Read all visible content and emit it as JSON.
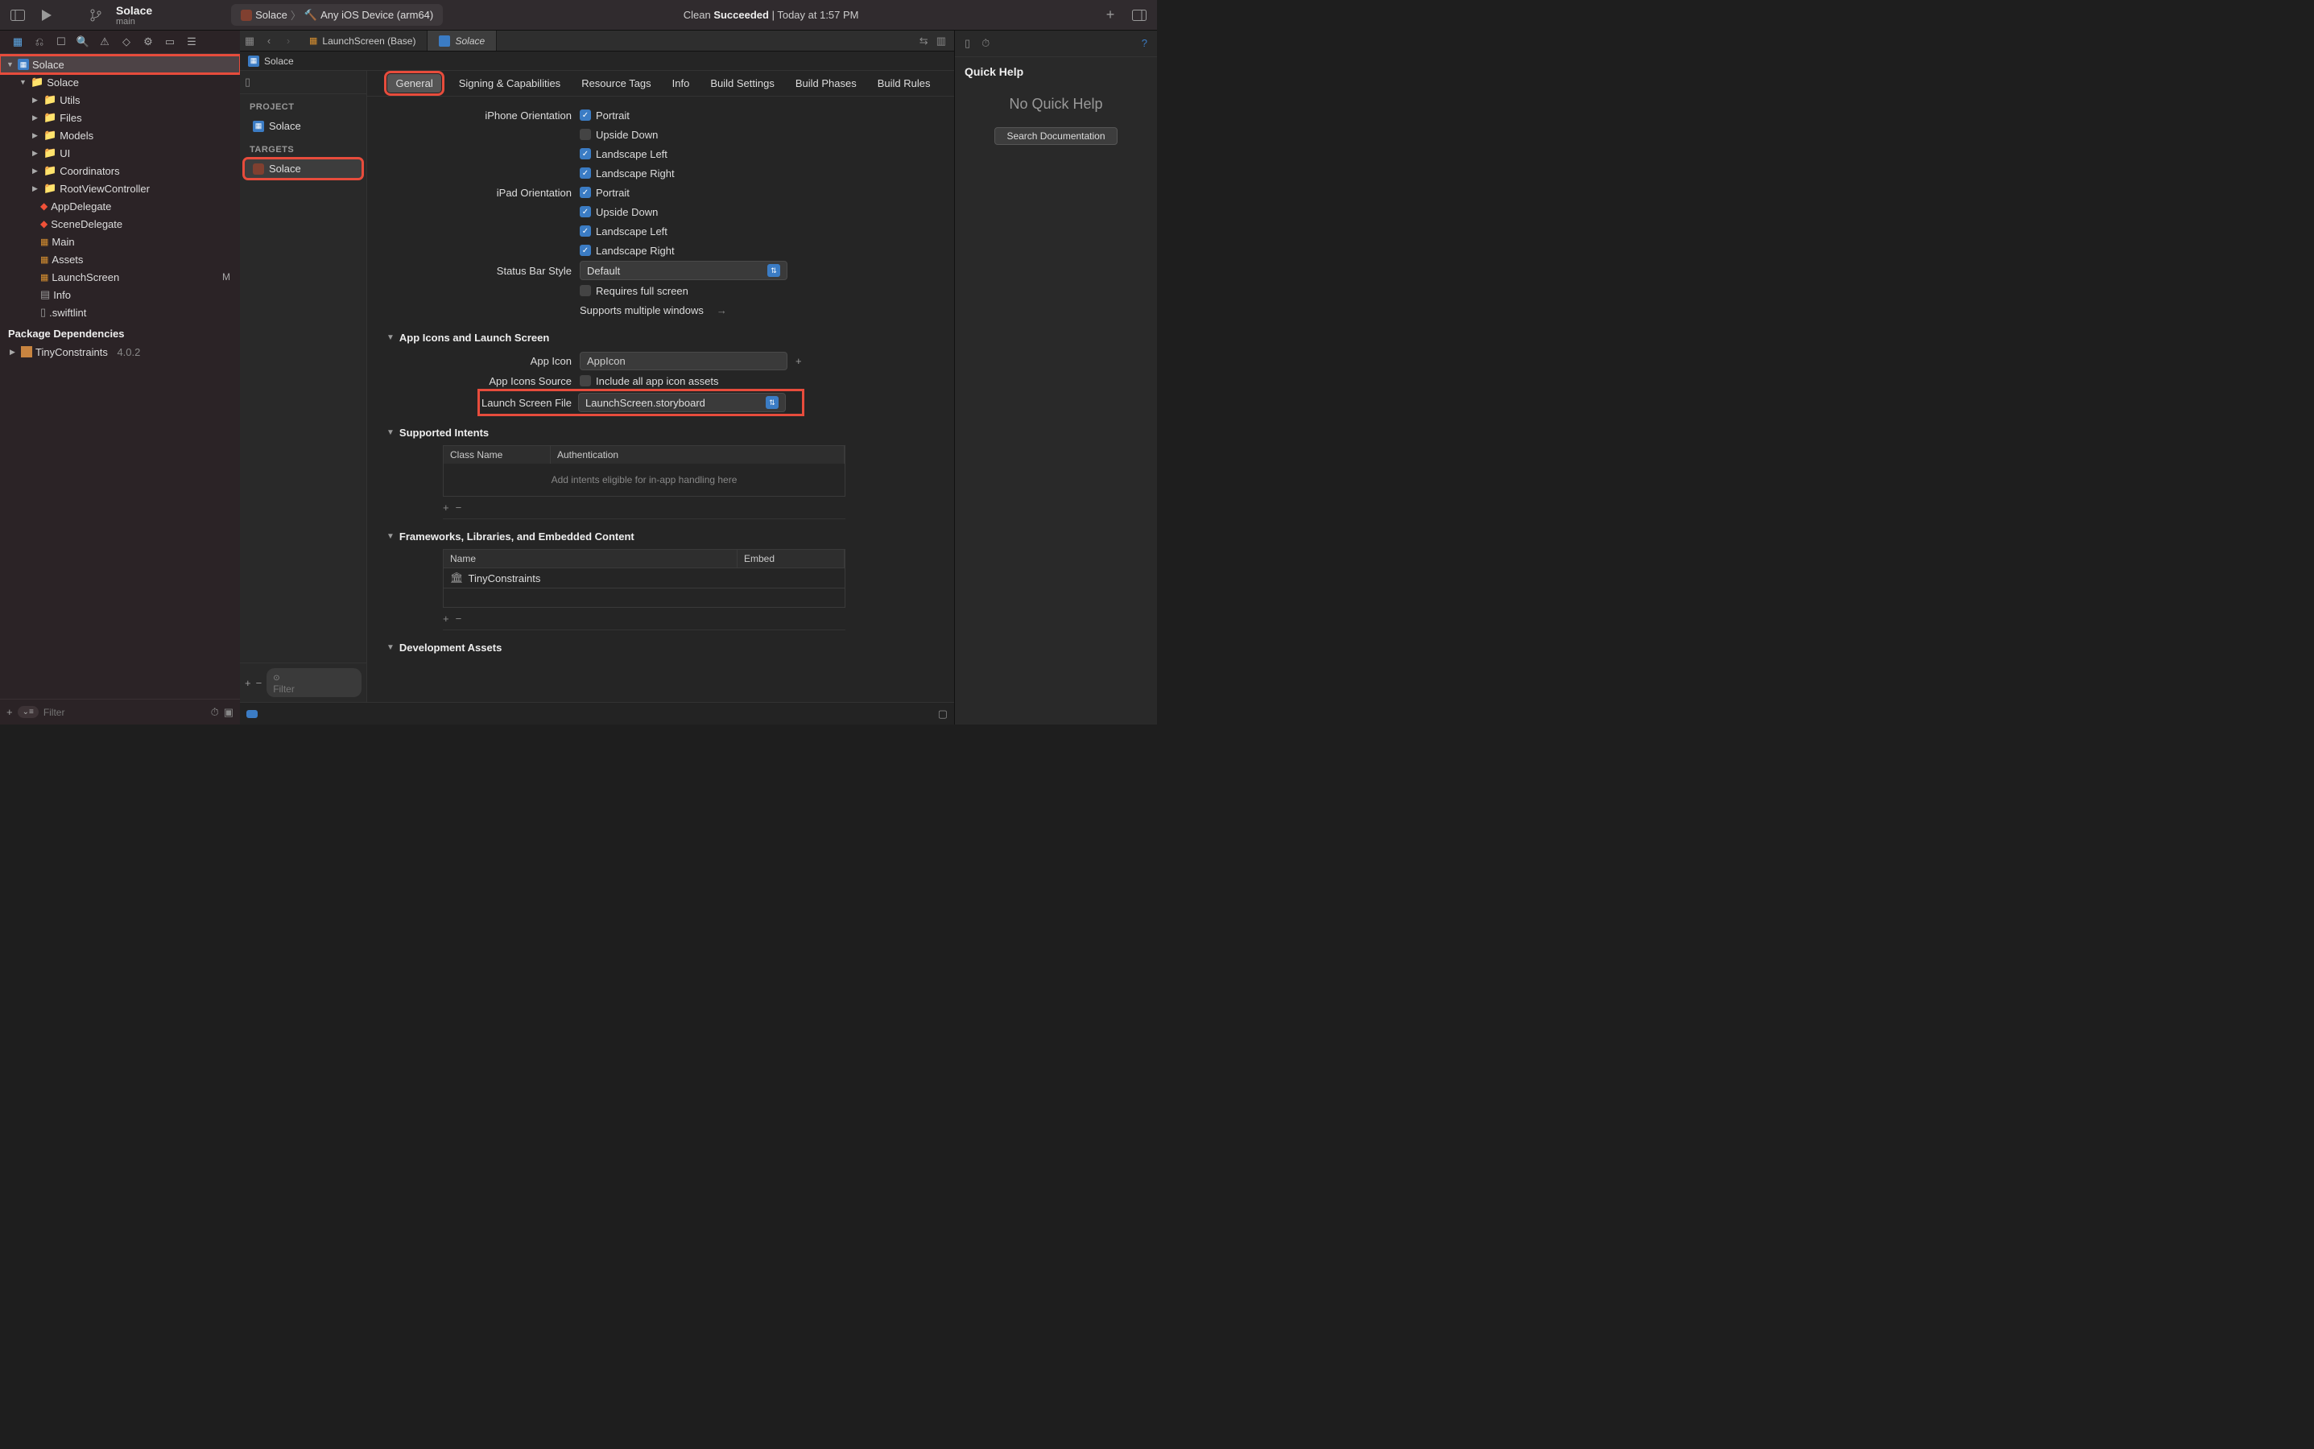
{
  "toolbar": {
    "project_name": "Solace",
    "branch": "main",
    "scheme_app": "Solace",
    "scheme_device": "Any iOS Device (arm64)",
    "status_prefix": "Clean ",
    "status_bold": "Succeeded",
    "status_suffix": " | Today at 1:57 PM"
  },
  "nav": {
    "root": "Solace",
    "items": [
      "Solace",
      "Utils",
      "Files",
      "Models",
      "UI",
      "Coordinators",
      "RootViewController",
      "AppDelegate",
      "SceneDelegate",
      "Main",
      "Assets",
      "LaunchScreen",
      "Info",
      ".swiftlint"
    ],
    "launchscreen_status": "M",
    "pkg_header": "Package Dependencies",
    "pkg_name": "TinyConstraints",
    "pkg_version": "4.0.2",
    "filter_placeholder": "Filter"
  },
  "tabs": {
    "t1": "LaunchScreen (Base)",
    "t2": "Solace",
    "breadcrumb": "Solace"
  },
  "targets": {
    "sec_project": "PROJECT",
    "proj_name": "Solace",
    "sec_targets": "TARGETS",
    "target_name": "Solace",
    "filter_placeholder": "Filter"
  },
  "settings_tabs": [
    "General",
    "Signing & Capabilities",
    "Resource Tags",
    "Info",
    "Build Settings",
    "Build Phases",
    "Build Rules"
  ],
  "form": {
    "iphone_orient_label": "iPhone Orientation",
    "ipad_orient_label": "iPad Orientation",
    "orient": [
      "Portrait",
      "Upside Down",
      "Landscape Left",
      "Landscape Right"
    ],
    "status_bar_label": "Status Bar Style",
    "status_bar_value": "Default",
    "full_screen": "Requires full screen",
    "multi_windows": "Supports multiple windows",
    "sec_icons": "App Icons and Launch Screen",
    "app_icon_label": "App Icon",
    "app_icon_value": "AppIcon",
    "icons_source_label": "App Icons Source",
    "icons_source_check": "Include all app icon assets",
    "launch_file_label": "Launch Screen File",
    "launch_file_value": "LaunchScreen.storyboard",
    "sec_intents": "Supported Intents",
    "intents_col1": "Class Name",
    "intents_col2": "Authentication",
    "intents_empty": "Add intents eligible for in-app handling here",
    "sec_frameworks": "Frameworks, Libraries, and Embedded Content",
    "fw_col1": "Name",
    "fw_col2": "Embed",
    "fw_item": "TinyConstraints",
    "sec_dev": "Development Assets"
  },
  "inspector": {
    "quick_help": "Quick Help",
    "no_help": "No Quick Help",
    "search_doc": "Search Documentation"
  }
}
